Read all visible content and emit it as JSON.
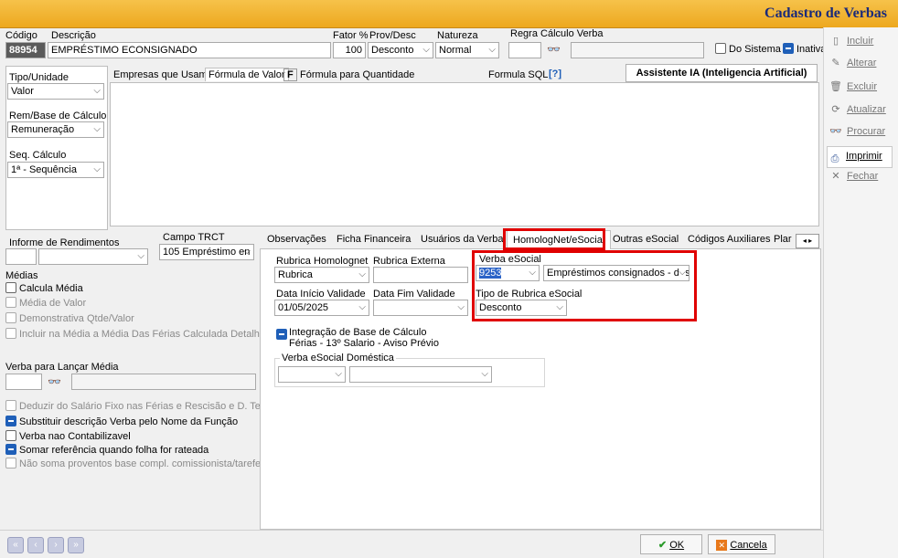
{
  "window": {
    "title": "Cadastro de Verbas"
  },
  "header": {
    "codigo_label": "Código",
    "codigo_value": "88954",
    "descricao_label": "Descrição",
    "descricao_value": "EMPRÉSTIMO ECONSIGNADO",
    "fator_label": "Fator %",
    "fator_value": "100",
    "provdesc_label": "Prov/Desc",
    "provdesc_value": "Desconto",
    "natureza_label": "Natureza",
    "natureza_value": "Normal",
    "regra_label": "Regra Cálculo Verba",
    "do_sistema_label": "Do Sistema",
    "inativa_label": "Inativa"
  },
  "side_actions": [
    {
      "label": "Incluir",
      "icon": "document-icon"
    },
    {
      "label": "Alterar",
      "icon": "pencil-icon"
    },
    {
      "label": "Excluir",
      "icon": "trash-icon"
    },
    {
      "label": "Atualizar",
      "icon": "refresh-icon"
    },
    {
      "label": "Procurar",
      "icon": "binoculars-icon"
    },
    {
      "label": "Imprimir",
      "icon": "printer-icon"
    },
    {
      "label": "Fechar",
      "icon": "close-icon"
    }
  ],
  "left": {
    "tipo_label": "Tipo/Unidade",
    "tipo_value": "Valor",
    "rem_label": "Rem/Base de Cálculo",
    "rem_value": "Remuneração",
    "seq_label": "Seq. Cálculo",
    "seq_value": "1ª - Sequência"
  },
  "formula_tabs": {
    "empresas": "Empresas que Usam",
    "valor": "Fórmula de Valor",
    "f_icon": "F",
    "quantidade": "Fórmula para Quantidade",
    "sql": "Formula SQL",
    "sql_icon": "[?]",
    "assistente": "Assistente IA (Inteligencia Artificial)"
  },
  "middle": {
    "informe_label": "Informe de Rendimentos",
    "trct_label": "Campo TRCT",
    "trct_value": "105 Empréstimo en",
    "medias_label": "Médias",
    "medias": [
      {
        "label": "Calcula Média",
        "checked": false,
        "disabled": false
      },
      {
        "label": "Média de Valor",
        "checked": false,
        "disabled": true
      },
      {
        "label": "Demonstrativa Qtde/Valor",
        "checked": false,
        "disabled": true
      },
      {
        "label": "Incluir na Média a Média Das Férias Calculada Detalhada",
        "checked": false,
        "disabled": true
      }
    ],
    "lancar_label": "Verba para Lançar Média",
    "options": [
      {
        "label": "Deduzir do Salário Fixo nas  Férias e Rescisão e D. Terceiro",
        "checked": false,
        "disabled": true
      },
      {
        "label": "Substituir descrição Verba pelo Nome da Função",
        "checked": true,
        "disabled": false
      },
      {
        "label": "Verba nao Contabilizavel",
        "checked": false,
        "disabled": false
      },
      {
        "label": "Somar referência quando folha for rateada",
        "checked": true,
        "disabled": false
      },
      {
        "label": "Não soma proventos base compl. comissionista/tarefeiro",
        "checked": false,
        "disabled": true
      }
    ]
  },
  "tabs": [
    "Observações",
    "Ficha Financeira",
    "Usuários da Verba",
    "HomologNet/eSocial",
    "Outras eSocial",
    "Códigos Auxiliares",
    "Plar"
  ],
  "active_tab": "HomologNet/eSocial",
  "esocial": {
    "rubrica_homolog_label": "Rubrica Homolognet",
    "rubrica_homolog_value": "Rubrica",
    "rubrica_externa_label": "Rubrica Externa",
    "verba_esocial_label": "Verba eSocial",
    "verba_code": "9253",
    "verba_desc": "Empréstimos consignados - desc",
    "data_inicio_label": "Data Início Validade",
    "data_inicio_value": "01/05/2025",
    "data_fim_label": "Data Fim Validade",
    "tipo_rubrica_label": "Tipo de Rubrica eSocial",
    "tipo_rubrica_value": "Desconto",
    "integracao_line1": "Integração de Base de Cálculo",
    "integracao_line2": "Férias - 13º Salario - Aviso Prévio",
    "domestica_label": "Verba eSocial Doméstica"
  },
  "footer": {
    "ok_label": "OK",
    "cancel_label": "Cancela"
  }
}
